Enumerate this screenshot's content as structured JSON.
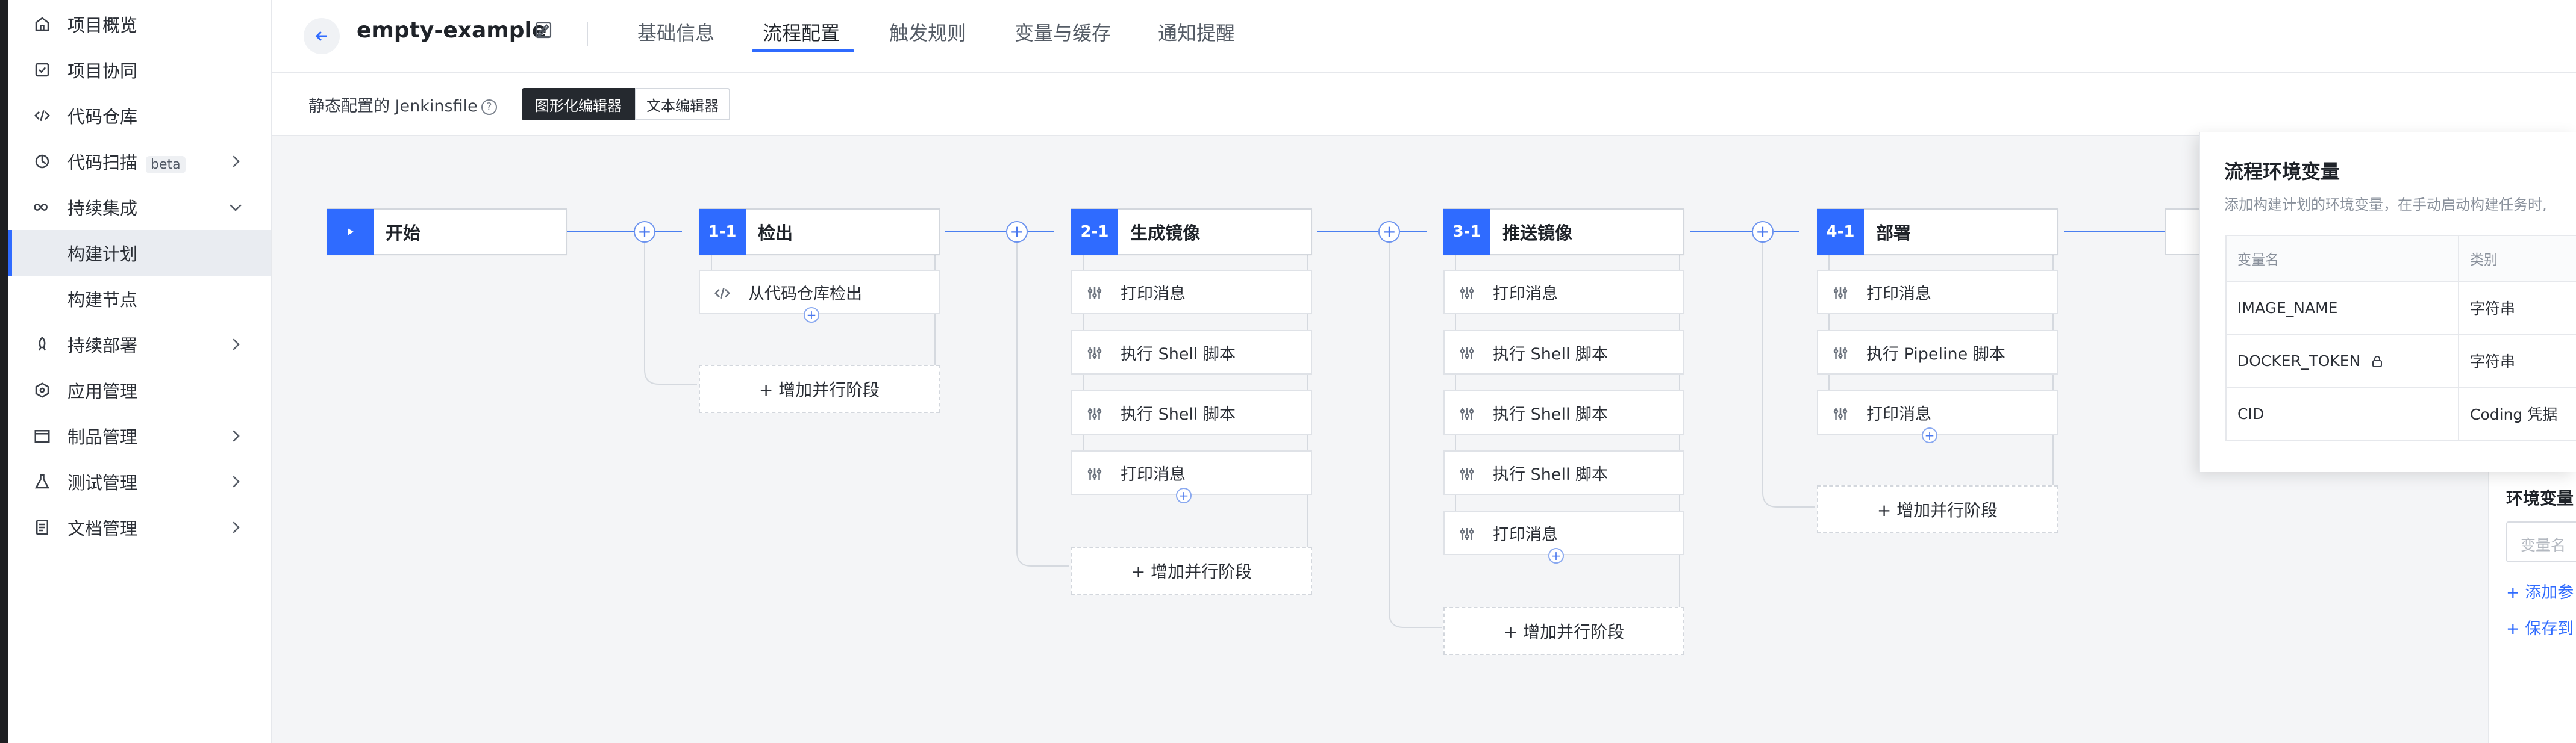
{
  "sidebar": {
    "items": [
      {
        "label": "项目概览",
        "icon": "home-icon"
      },
      {
        "label": "项目协同",
        "icon": "collab-icon"
      },
      {
        "label": "代码仓库",
        "icon": "code-icon"
      },
      {
        "label": "代码扫描",
        "badge": "beta",
        "icon": "scan-icon"
      },
      {
        "label": "持续集成",
        "icon": "infinity-icon"
      },
      {
        "label": "构建计划"
      },
      {
        "label": "构建节点"
      },
      {
        "label": "持续部署",
        "icon": "rocket-icon"
      },
      {
        "label": "应用管理",
        "icon": "app-icon"
      },
      {
        "label": "制品管理",
        "icon": "box-icon"
      },
      {
        "label": "测试管理",
        "icon": "flask-icon"
      },
      {
        "label": "文档管理",
        "icon": "doc-icon"
      }
    ]
  },
  "header": {
    "title": "empty-example",
    "tabs": [
      "基础信息",
      "流程配置",
      "触发规则",
      "变量与缓存",
      "通知提醒"
    ],
    "active_tab": "流程配置"
  },
  "toolbar": {
    "jenkins_label": "静态配置的 Jenkinsfile",
    "help_glyph": "?",
    "graphic_editor": "图形化编辑器",
    "text_editor": "文本编辑器"
  },
  "pipeline": {
    "start": {
      "label": "开始"
    },
    "stages": [
      {
        "num": "1-1",
        "name": "检出",
        "steps": [
          "从代码仓库检出"
        ],
        "add_parallel": "+ 增加并行阶段"
      },
      {
        "num": "2-1",
        "name": "生成镜像",
        "steps": [
          "打印消息",
          "执行 Shell 脚本",
          "执行 Shell 脚本",
          "打印消息"
        ],
        "add_parallel": "+ 增加并行阶段"
      },
      {
        "num": "3-1",
        "name": "推送镜像",
        "steps": [
          "打印消息",
          "执行 Shell 脚本",
          "执行 Shell 脚本",
          "执行 Shell 脚本",
          "打印消息"
        ],
        "add_parallel": "+ 增加并行阶段"
      },
      {
        "num": "4-1",
        "name": "部署",
        "steps": [
          "打印消息",
          "执行 Pipeline 脚本",
          "打印消息"
        ],
        "add_parallel": "+ 增加并行阶段"
      }
    ]
  },
  "env_panel": {
    "title": "流程环境变量",
    "desc": "添加构建计划的环境变量，在手动启动构建任务时,",
    "col_name": "变量名",
    "col_type": "类别",
    "rows": [
      {
        "name": "IMAGE_NAME",
        "type": "字符串"
      },
      {
        "name": "DOCKER_TOKEN",
        "type": "字符串",
        "locked": true
      },
      {
        "name": "CID",
        "type": "Coding 凭据"
      }
    ]
  },
  "right_panel": {
    "title": "环境变量",
    "placeholder": "变量名",
    "add_param": "+ 添加参",
    "save_to": "+ 保存到"
  },
  "colors": {
    "accent": "#2f6bff",
    "sidebar_active": "#e9ecf1"
  }
}
